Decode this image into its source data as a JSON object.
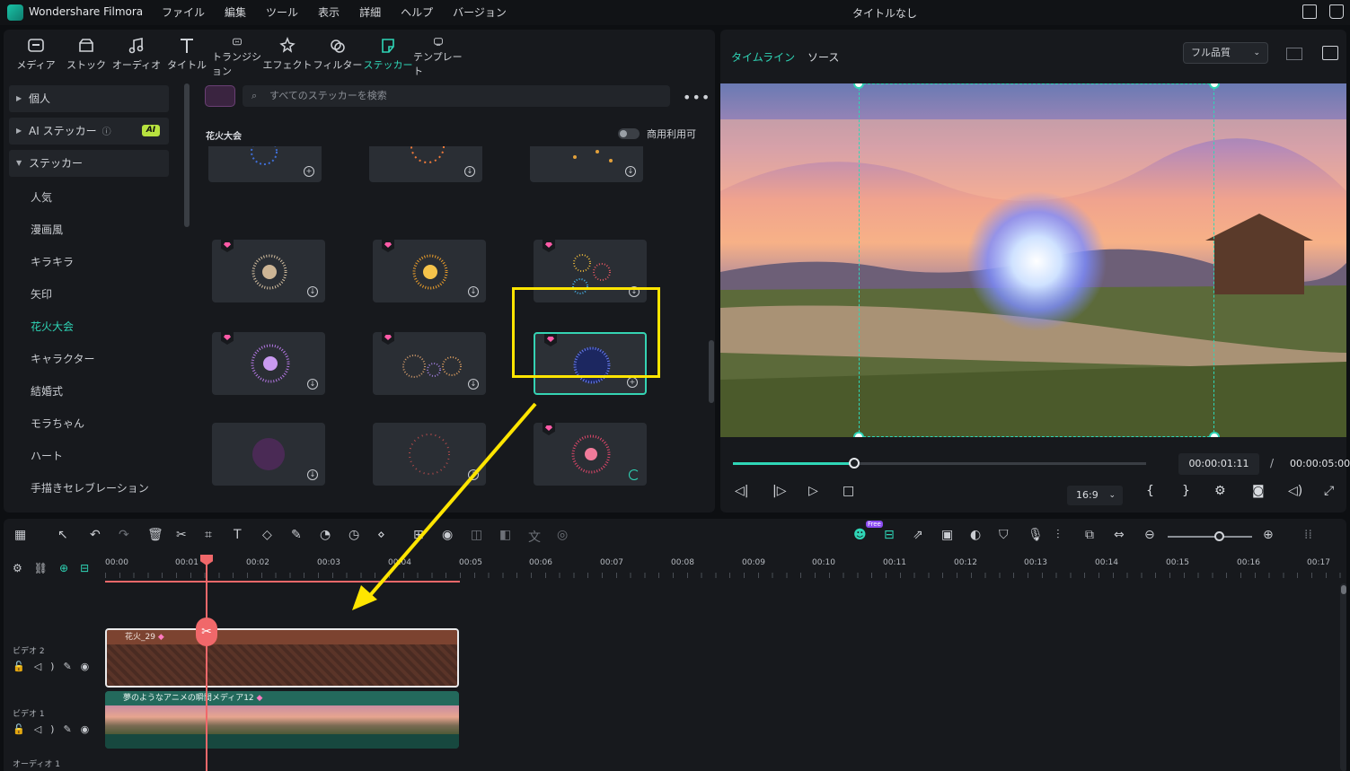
{
  "titlebar": {
    "app_name": "Wondershare Filmora",
    "menu": [
      "ファイル",
      "編集",
      "ツール",
      "表示",
      "詳細",
      "ヘルプ",
      "バージョン"
    ],
    "doc_title": "タイトルなし"
  },
  "library": {
    "tabs": [
      {
        "label": "メディア",
        "icon": "media-icon"
      },
      {
        "label": "ストック",
        "icon": "stock-icon"
      },
      {
        "label": "オーディオ",
        "icon": "music-icon"
      },
      {
        "label": "タイトル",
        "icon": "title-icon"
      },
      {
        "label": "トランジション",
        "icon": "transition-icon"
      },
      {
        "label": "エフェクト",
        "icon": "effect-icon"
      },
      {
        "label": "フィルター",
        "icon": "filter-icon"
      },
      {
        "label": "ステッカー",
        "icon": "sticker-icon",
        "active": true
      },
      {
        "label": "テンプレート",
        "icon": "template-icon"
      }
    ],
    "sidebar": {
      "groups": [
        "個人",
        "AI ステッカー",
        "ステッカー"
      ],
      "ai_badge": "AI",
      "items": [
        "人気",
        "漫画風",
        "キラキラ",
        "矢印",
        "花火大会",
        "キャラクター",
        "結婚式",
        "モラちゃん",
        "ハート",
        "手描きセレブレーション"
      ],
      "active_item": "花火大会"
    },
    "search_placeholder": "すべてのステッカーを検索",
    "more": "•••",
    "section_title": "花火大会",
    "commercial_label": "商用利用可"
  },
  "preview": {
    "tabs": [
      "タイムライン",
      "ソース"
    ],
    "quality": "フル品質",
    "current_time": "00:00:01:11",
    "separator": "/",
    "total_time": "00:00:05:00",
    "ratio": "16:9",
    "progress": 0.29
  },
  "timeline": {
    "ruler": [
      "00:00",
      "00:01",
      "00:02",
      "00:03",
      "00:04",
      "00:05",
      "00:06",
      "00:07",
      "00:08",
      "00:09",
      "00:10",
      "00:11",
      "00:12",
      "00:13",
      "00:14",
      "00:15",
      "00:16",
      "00:17"
    ],
    "tracks": {
      "video2": {
        "name": "ビデオ 2",
        "clip": "花火_29"
      },
      "video1": {
        "name": "ビデオ 1",
        "clip": "夢のようなアニメの瞬間メディア12"
      },
      "audio1": {
        "name": "オーディオ 1"
      }
    },
    "new_badge": "Free"
  },
  "colors": {
    "accent": "#2fd6b7",
    "highlight": "#ffe500",
    "playhead": "#f0686a"
  }
}
